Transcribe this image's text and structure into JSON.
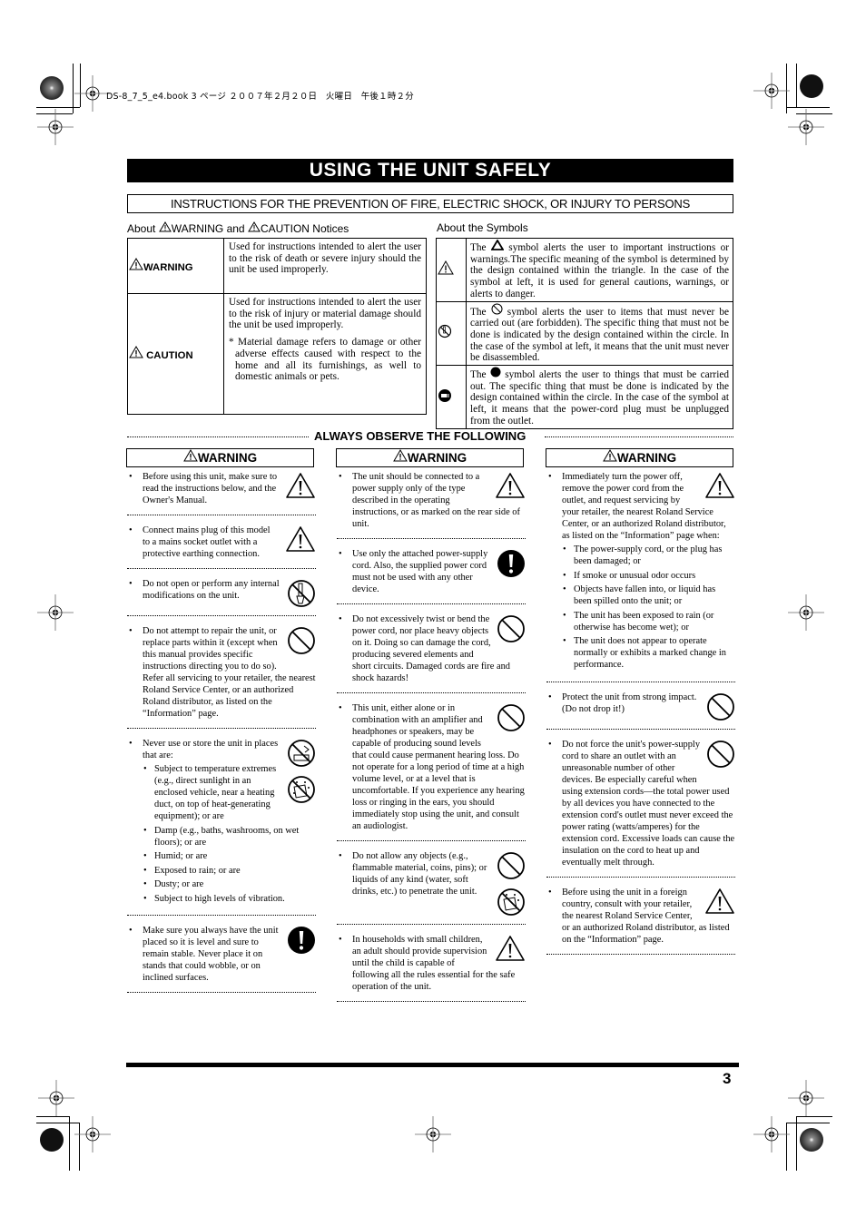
{
  "print_header": "DS-8_7_5_e4.book  3 ページ  ２００７年２月２０日　火曜日　午後１時２分",
  "title": "USING THE UNIT SAFELY",
  "subtitle": "INSTRUCTIONS FOR THE PREVENTION OF FIRE, ELECTRIC SHOCK, OR INJURY TO PERSONS",
  "notices": {
    "caption_pre": "About",
    "caption_warning": "WARNING and",
    "caption_caution": "CAUTION Notices",
    "rows": [
      {
        "label": "WARNING",
        "text": "Used for instructions intended to alert the user to the risk of death or severe injury should the unit be used improperly."
      },
      {
        "label": "CAUTION",
        "text": "Used for instructions intended to alert the user to the risk of injury or material damage should the unit be used improperly.",
        "note": "* Material damage refers to damage or other adverse effects caused with respect to the home and all its furnishings, as well to domestic animals or pets."
      }
    ]
  },
  "symbols": {
    "caption": "About the Symbols",
    "rows": [
      {
        "icon": "warning-triangle",
        "pre": "The",
        "post": "symbol alerts the user to important instructions or warnings.The specific meaning of the symbol is determined by the design contained within the triangle. In the case of the symbol at left, it is used for general cautions, warnings, or alerts to danger."
      },
      {
        "icon": "prohibition-circle",
        "pre": "The",
        "post": "symbol alerts the user to items that must never be carried out (are forbidden). The specific thing that must not be done is indicated by the design contained within the circle. In the case of the symbol at left, it means that the unit must never be disassembled."
      },
      {
        "icon": "mandatory-dot",
        "pre": "The",
        "post": "symbol alerts the user to things that must be carried out. The specific thing that must be done is indicated by the design contained within the circle. In the case of the symbol at left, it means that the power-cord plug must be unplugged from the outlet."
      }
    ]
  },
  "observe_heading": "ALWAYS OBSERVE THE FOLLOWING",
  "warning_label": "WARNING",
  "columns": [
    {
      "items": [
        {
          "icon": "warning",
          "text": "Before using this unit, make sure to read the instructions below, and the Owner's Manual."
        },
        {
          "icon": "warning",
          "text": "Connect mains plug of this model to a mains socket outlet with a protective earthing connection."
        },
        {
          "icon": "no-disassemble",
          "text": "Do not open or perform any internal modifications on the unit."
        },
        {
          "icon": "prohibited",
          "text": "Do not attempt to repair the unit, or replace parts within it (except when this manual provides specific instructions directing you to do so). Refer all servicing to your retailer, the nearest Roland Service Center, or an authorized Roland distributor, as listed on the “Information” page."
        },
        {
          "icon": "no-wet-heat",
          "text": "Never use or store the unit in places that are:",
          "sub": [
            "Subject to temperature extremes (e.g., direct sunlight in an enclosed vehicle, near a heating duct, on top of heat-generating equipment); or are",
            "Damp (e.g., baths, washrooms, on wet floors); or are",
            "Humid; or are",
            "Exposed to rain; or are",
            "Dusty; or are",
            "Subject to high levels of vibration."
          ]
        },
        {
          "icon": "mandatory",
          "text": "Make sure you always have the unit placed so it is level and sure to remain stable. Never place it on stands that could wobble, or on inclined surfaces."
        }
      ]
    },
    {
      "items": [
        {
          "icon": "warning",
          "text": "The unit should be connected to a power supply only of the type described in the operating instructions, or as marked on the rear side of unit."
        },
        {
          "icon": "mandatory",
          "text": "Use only the attached power-supply cord. Also, the supplied power cord must not be used with any other device."
        },
        {
          "icon": "prohibited",
          "text": "Do not excessively twist or bend the power cord, nor place heavy objects on it. Doing so can damage the cord, producing severed elements and short circuits. Damaged cords are fire and shock hazards!"
        },
        {
          "icon": "prohibited",
          "text": "This unit, either alone or in combination with an amplifier and headphones or speakers, may be capable of producing sound levels that could cause permanent hearing loss. Do not operate for a long period of time at a high volume level, or at a level that is uncomfortable. If you experience any hearing loss or ringing in the ears, you should immediately stop using the unit, and consult an audiologist."
        },
        {
          "icon": "prohibited-liquid",
          "text": "Do not allow any objects (e.g., flammable material, coins, pins); or liquids of any kind (water, soft drinks, etc.) to penetrate the unit."
        },
        {
          "icon": "warning",
          "text": "In households with small children, an adult should provide supervision until the child is capable of following all the rules essential for the safe operation of the unit."
        }
      ]
    },
    {
      "items": [
        {
          "icon": "warning",
          "text": "Immediately turn the power off, remove the power cord from the outlet, and request servicing by your retailer, the nearest Roland Service Center, or an authorized Roland distributor, as listed on the “Information” page when:",
          "sub": [
            "The power-supply cord, or the plug has been damaged; or",
            "If smoke or unusual odor occurs",
            "Objects have fallen into, or liquid has been spilled onto the unit; or",
            "The unit has been exposed to rain (or otherwise has become wet); or",
            "The unit does not appear to operate normally or exhibits a marked change in performance."
          ]
        },
        {
          "icon": "prohibited",
          "text": "Protect the unit from strong impact.\n(Do not drop it!)"
        },
        {
          "icon": "prohibited",
          "text": "Do not force the unit's power-supply cord to share an outlet with an unreasonable number of other devices. Be especially careful when using extension cords—the total power used by all devices you have connected to the extension cord's outlet must never exceed the power rating (watts/amperes) for the extension cord. Excessive loads can cause the insulation on the cord to heat up and eventually melt through."
        },
        {
          "icon": "warning",
          "text": "Before using the unit in a foreign country, consult with your retailer, the nearest Roland Service Center, or an authorized Roland distributor, as listed on the “Information” page."
        }
      ]
    }
  ],
  "page_number": "3"
}
